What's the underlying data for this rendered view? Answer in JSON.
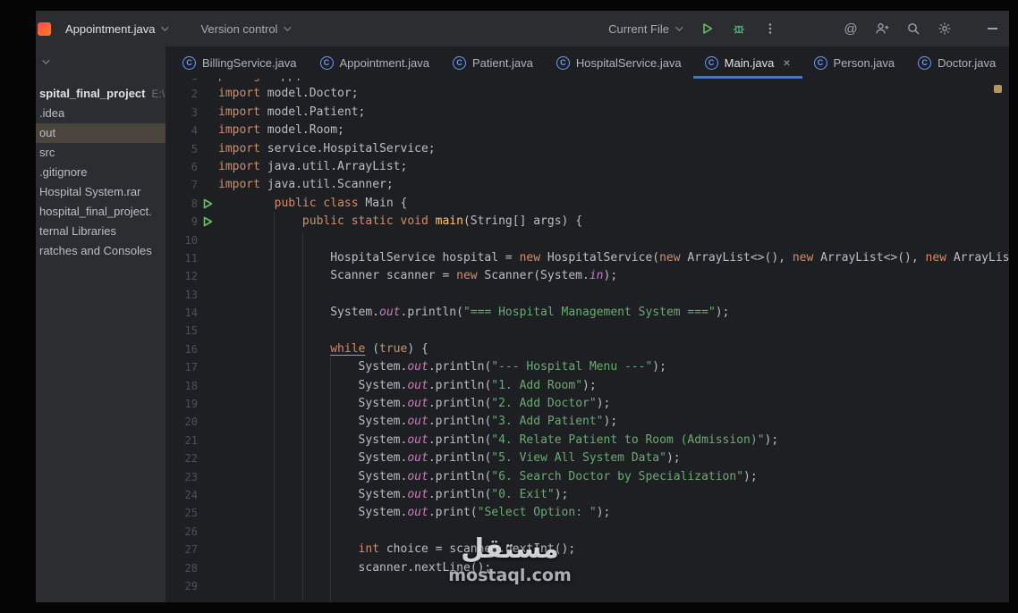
{
  "titlebar": {
    "file_widget": "Appointment.java",
    "vcs_widget": "Version control",
    "run_config": "Current File"
  },
  "tabs": [
    {
      "label": "BillingService.java",
      "active": false
    },
    {
      "label": "Appointment.java",
      "active": false
    },
    {
      "label": "Patient.java",
      "active": false
    },
    {
      "label": "HospitalService.java",
      "active": false
    },
    {
      "label": "Main.java",
      "active": true
    },
    {
      "label": "Person.java",
      "active": false
    },
    {
      "label": "Doctor.java",
      "active": false
    }
  ],
  "project": {
    "items": [
      {
        "label": "spital_final_project",
        "suffix": "E:\\",
        "root": true
      },
      {
        "label": ".idea"
      },
      {
        "label": "out",
        "selected": true
      },
      {
        "label": "src"
      },
      {
        "label": ".gitignore"
      },
      {
        "label": "Hospital System.rar"
      },
      {
        "label": "hospital_final_project."
      },
      {
        "label": "ternal Libraries"
      },
      {
        "label": "ratches and Consoles"
      }
    ]
  },
  "editor": {
    "lines": [
      {
        "n": 1,
        "i": 0,
        "t": [
          [
            "k",
            "package"
          ],
          [
            "d",
            " app;"
          ]
        ]
      },
      {
        "n": 2,
        "i": 0,
        "t": [
          [
            "k",
            "import"
          ],
          [
            "d",
            " model.Doctor;"
          ]
        ]
      },
      {
        "n": 3,
        "i": 0,
        "t": [
          [
            "k",
            "import"
          ],
          [
            "d",
            " model.Patient;"
          ]
        ]
      },
      {
        "n": 4,
        "i": 0,
        "t": [
          [
            "k",
            "import"
          ],
          [
            "d",
            " model.Room;"
          ]
        ]
      },
      {
        "n": 5,
        "i": 0,
        "t": [
          [
            "k",
            "import"
          ],
          [
            "d",
            " service.HospitalService;"
          ]
        ]
      },
      {
        "n": 6,
        "i": 0,
        "t": [
          [
            "k",
            "import"
          ],
          [
            "d",
            " java.util.ArrayList;"
          ]
        ]
      },
      {
        "n": 7,
        "i": 0,
        "t": [
          [
            "k",
            "import"
          ],
          [
            "d",
            " java.util.Scanner;"
          ]
        ]
      },
      {
        "n": 8,
        "i": 8,
        "r": true,
        "t": [
          [
            "k",
            "public"
          ],
          [
            "d",
            " "
          ],
          [
            "k",
            "class"
          ],
          [
            "d",
            " Main {"
          ]
        ]
      },
      {
        "n": 9,
        "i": 12,
        "r": true,
        "t": [
          [
            "k",
            "public"
          ],
          [
            "d",
            " "
          ],
          [
            "k",
            "static"
          ],
          [
            "d",
            " "
          ],
          [
            "k",
            "void"
          ],
          [
            "d",
            " "
          ],
          [
            "m",
            "main"
          ],
          [
            "d",
            "(String[] args) {"
          ]
        ]
      },
      {
        "n": 10,
        "i": 0,
        "t": []
      },
      {
        "n": 11,
        "i": 16,
        "t": [
          [
            "d",
            "HospitalService hospital = "
          ],
          [
            "k",
            "new"
          ],
          [
            "d",
            " HospitalService("
          ],
          [
            "k",
            "new"
          ],
          [
            "d",
            " ArrayList<>(), "
          ],
          [
            "k",
            "new"
          ],
          [
            "d",
            " ArrayList<>(), "
          ],
          [
            "k",
            "new"
          ],
          [
            "d",
            " ArrayList<>());"
          ]
        ]
      },
      {
        "n": 12,
        "i": 16,
        "t": [
          [
            "d",
            "Scanner scanner = "
          ],
          [
            "k",
            "new"
          ],
          [
            "d",
            " Scanner(System."
          ],
          [
            "f",
            "in"
          ],
          [
            "d",
            ");"
          ]
        ]
      },
      {
        "n": 13,
        "i": 0,
        "t": []
      },
      {
        "n": 14,
        "i": 16,
        "t": [
          [
            "d",
            "System."
          ],
          [
            "f",
            "out"
          ],
          [
            "d",
            ".println("
          ],
          [
            "s",
            "\"=== Hospital Management System ===\""
          ],
          [
            "d",
            ");"
          ]
        ]
      },
      {
        "n": 15,
        "i": 0,
        "t": []
      },
      {
        "n": 16,
        "i": 16,
        "t": [
          [
            "w",
            "while"
          ],
          [
            "d",
            " ("
          ],
          [
            "k",
            "true"
          ],
          [
            "d",
            ") {"
          ]
        ]
      },
      {
        "n": 17,
        "i": 20,
        "t": [
          [
            "d",
            "System."
          ],
          [
            "f",
            "out"
          ],
          [
            "d",
            ".println("
          ],
          [
            "s",
            "\"--- Hospital Menu ---\""
          ],
          [
            "d",
            ");"
          ]
        ]
      },
      {
        "n": 18,
        "i": 20,
        "t": [
          [
            "d",
            "System."
          ],
          [
            "f",
            "out"
          ],
          [
            "d",
            ".println("
          ],
          [
            "s",
            "\"1. Add Room\""
          ],
          [
            "d",
            ");"
          ]
        ]
      },
      {
        "n": 19,
        "i": 20,
        "t": [
          [
            "d",
            "System."
          ],
          [
            "f",
            "out"
          ],
          [
            "d",
            ".println("
          ],
          [
            "s",
            "\"2. Add Doctor\""
          ],
          [
            "d",
            ");"
          ]
        ]
      },
      {
        "n": 20,
        "i": 20,
        "t": [
          [
            "d",
            "System."
          ],
          [
            "f",
            "out"
          ],
          [
            "d",
            ".println("
          ],
          [
            "s",
            "\"3. Add Patient\""
          ],
          [
            "d",
            ");"
          ]
        ]
      },
      {
        "n": 21,
        "i": 20,
        "t": [
          [
            "d",
            "System."
          ],
          [
            "f",
            "out"
          ],
          [
            "d",
            ".println("
          ],
          [
            "s",
            "\"4. Relate Patient to Room (Admission)\""
          ],
          [
            "d",
            ");"
          ]
        ]
      },
      {
        "n": 22,
        "i": 20,
        "t": [
          [
            "d",
            "System."
          ],
          [
            "f",
            "out"
          ],
          [
            "d",
            ".println("
          ],
          [
            "s",
            "\"5. View All System Data\""
          ],
          [
            "d",
            ");"
          ]
        ]
      },
      {
        "n": 23,
        "i": 20,
        "t": [
          [
            "d",
            "System."
          ],
          [
            "f",
            "out"
          ],
          [
            "d",
            ".println("
          ],
          [
            "s",
            "\"6. Search Doctor by Specialization\""
          ],
          [
            "d",
            ");"
          ]
        ]
      },
      {
        "n": 24,
        "i": 20,
        "t": [
          [
            "d",
            "System."
          ],
          [
            "f",
            "out"
          ],
          [
            "d",
            ".println("
          ],
          [
            "s",
            "\"0. Exit\""
          ],
          [
            "d",
            ");"
          ]
        ]
      },
      {
        "n": 25,
        "i": 20,
        "t": [
          [
            "d",
            "System."
          ],
          [
            "f",
            "out"
          ],
          [
            "d",
            ".print("
          ],
          [
            "s",
            "\"Select Option: \""
          ],
          [
            "d",
            ");"
          ]
        ]
      },
      {
        "n": 26,
        "i": 0,
        "t": []
      },
      {
        "n": 27,
        "i": 20,
        "t": [
          [
            "k",
            "int"
          ],
          [
            "d",
            " choice = scanner.nextInt();"
          ]
        ]
      },
      {
        "n": 28,
        "i": 20,
        "t": [
          [
            "d",
            "scanner.nextLine();"
          ]
        ]
      },
      {
        "n": 29,
        "i": 0,
        "t": []
      }
    ]
  },
  "watermark": {
    "title": "مستقل",
    "site": "mostaql.com"
  },
  "colors": {
    "accent_blue": "#3574f0",
    "run_green": "#6ec06e",
    "keyword": "#cf8e6d",
    "string": "#6aab73",
    "field": "#c77dbb",
    "selection_row": "#4a443c"
  }
}
